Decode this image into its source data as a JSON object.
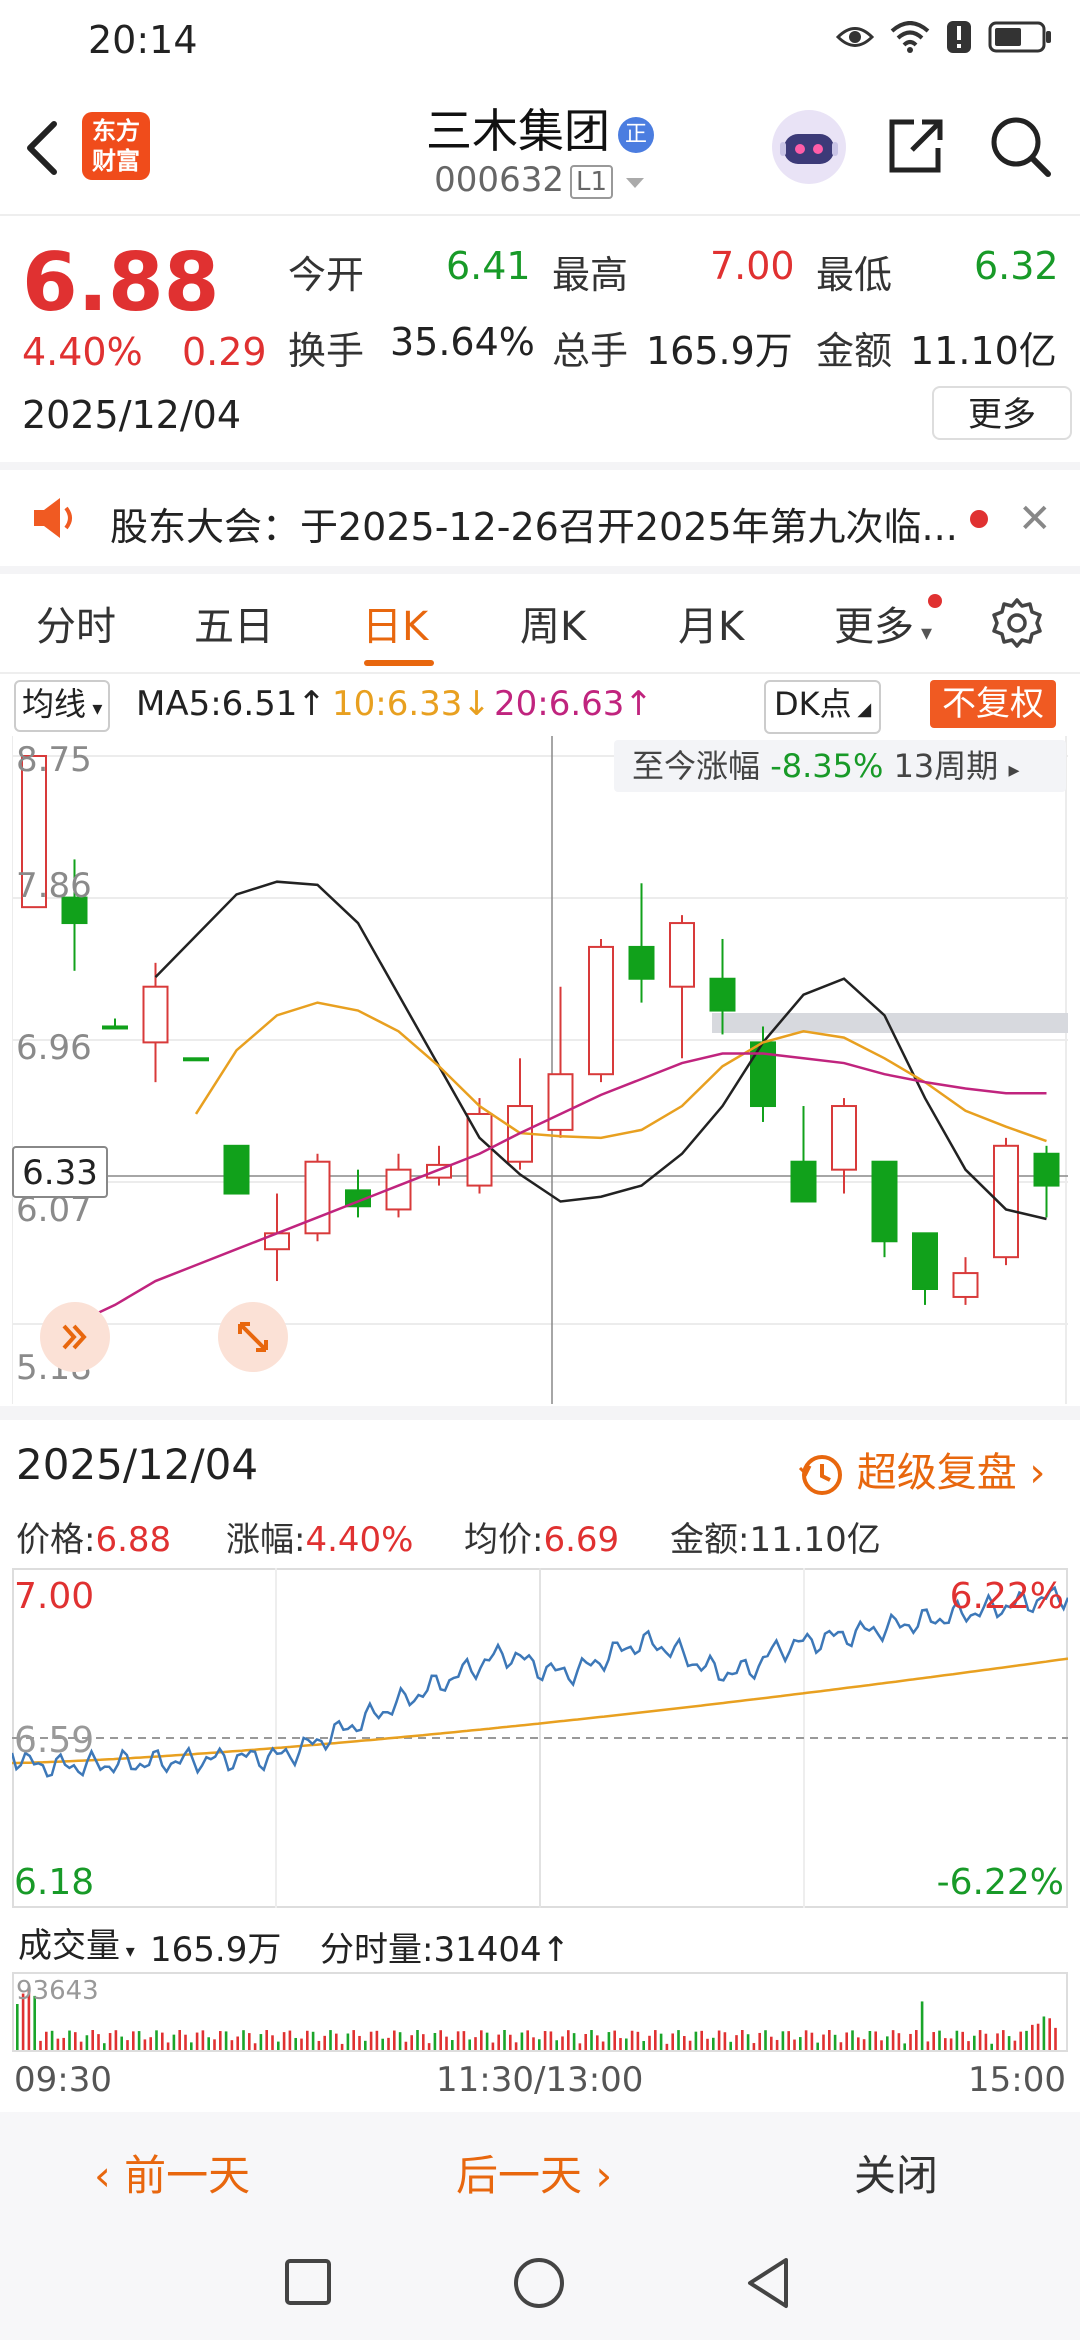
{
  "status": {
    "time": "20:14"
  },
  "header": {
    "logo_text": "东方财富",
    "stock_name": "三木集团",
    "stock_badge": "正",
    "stock_code": "000632",
    "level_badge": "L1"
  },
  "quote": {
    "price": "6.88",
    "change_pct": "4.40%",
    "change": "0.29",
    "date": "2025/12/04",
    "open_label": "今开",
    "open": "6.41",
    "high_label": "最高",
    "high": "7.00",
    "low_label": "最低",
    "low": "6.32",
    "turnover_label": "换手",
    "turnover": "35.64%",
    "volume_label": "总手",
    "volume": "165.9万",
    "amount_label": "金额",
    "amount": "11.10亿",
    "more_label": "更多"
  },
  "announcement": {
    "text": "股东大会：于2025-12-26召开2025年第九次临..."
  },
  "tabs": [
    "分时",
    "五日",
    "日K",
    "周K",
    "月K",
    "更多"
  ],
  "active_tab": "日K",
  "ma": {
    "selector": "均线",
    "ma5": "MA5:6.51↑",
    "ma10": "10:6.33↓",
    "ma20": "20:6.63↑",
    "dk": "DK点",
    "adjust": "不复权"
  },
  "kchart": {
    "y_labels": [
      "8.75",
      "7.86",
      "6.96",
      "6.07",
      "5.18"
    ],
    "crosshair_price": "6.33",
    "period_label": "至今涨幅",
    "period_change": "-8.35%",
    "period_count": "13周期",
    "colors": {
      "up": "#d83a3a",
      "down": "#11a11b",
      "ma5": "#222222",
      "ma10": "#e8a020",
      "ma20": "#c0247e"
    }
  },
  "chart_data": {
    "type": "candlestick",
    "y_range": [
      5.18,
      8.75
    ],
    "candles": [
      {
        "o": 7.8,
        "h": 8.75,
        "l": 7.8,
        "c": 8.75,
        "up": true
      },
      {
        "o": 7.86,
        "h": 8.1,
        "l": 7.4,
        "c": 7.7,
        "up": false
      },
      {
        "o": 7.05,
        "h": 7.1,
        "l": 7.05,
        "c": 7.05,
        "up": false
      },
      {
        "o": 6.95,
        "h": 7.45,
        "l": 6.7,
        "c": 7.3,
        "up": true
      },
      {
        "o": 6.85,
        "h": 6.85,
        "l": 6.85,
        "c": 6.85,
        "up": false
      },
      {
        "o": 6.3,
        "h": 6.3,
        "l": 6.0,
        "c": 6.0,
        "up": false
      },
      {
        "o": 5.65,
        "h": 6.0,
        "l": 5.45,
        "c": 5.75,
        "up": true
      },
      {
        "o": 5.75,
        "h": 6.25,
        "l": 5.7,
        "c": 6.2,
        "up": true
      },
      {
        "o": 6.02,
        "h": 6.15,
        "l": 5.85,
        "c": 5.92,
        "up": false
      },
      {
        "o": 5.9,
        "h": 6.25,
        "l": 5.85,
        "c": 6.15,
        "up": true
      },
      {
        "o": 6.1,
        "h": 6.3,
        "l": 6.05,
        "c": 6.18,
        "up": true
      },
      {
        "o": 6.05,
        "h": 6.6,
        "l": 6.0,
        "c": 6.5,
        "up": true
      },
      {
        "o": 6.2,
        "h": 6.85,
        "l": 6.15,
        "c": 6.55,
        "up": true
      },
      {
        "o": 6.4,
        "h": 7.3,
        "l": 6.35,
        "c": 6.75,
        "up": true
      },
      {
        "o": 6.75,
        "h": 7.6,
        "l": 6.7,
        "c": 7.55,
        "up": true
      },
      {
        "o": 7.55,
        "h": 7.95,
        "l": 7.2,
        "c": 7.35,
        "up": false
      },
      {
        "o": 7.3,
        "h": 7.75,
        "l": 6.85,
        "c": 7.7,
        "up": true
      },
      {
        "o": 7.35,
        "h": 7.6,
        "l": 7.0,
        "c": 7.15,
        "up": false
      },
      {
        "o": 6.95,
        "h": 7.05,
        "l": 6.45,
        "c": 6.55,
        "up": false
      },
      {
        "o": 6.2,
        "h": 6.55,
        "l": 5.95,
        "c": 5.95,
        "up": false
      },
      {
        "o": 6.15,
        "h": 6.6,
        "l": 6.0,
        "c": 6.55,
        "up": true
      },
      {
        "o": 6.2,
        "h": 6.2,
        "l": 5.6,
        "c": 5.7,
        "up": false
      },
      {
        "o": 5.75,
        "h": 5.75,
        "l": 5.3,
        "c": 5.4,
        "up": false
      },
      {
        "o": 5.35,
        "h": 5.6,
        "l": 5.3,
        "c": 5.5,
        "up": true
      },
      {
        "o": 5.6,
        "h": 6.35,
        "l": 5.55,
        "c": 6.3,
        "up": true
      },
      {
        "o": 6.25,
        "h": 6.3,
        "l": 5.85,
        "c": 6.05,
        "up": false
      }
    ],
    "ma5": [
      null,
      null,
      null,
      7.36,
      7.62,
      7.88,
      7.96,
      7.94,
      7.7,
      7.25,
      6.8,
      6.35,
      6.12,
      5.95,
      5.98,
      6.05,
      6.25,
      6.55,
      6.95,
      7.25,
      7.35,
      7.12,
      6.6,
      6.15,
      5.9,
      5.84
    ],
    "ma10": [
      null,
      null,
      null,
      null,
      6.5,
      6.9,
      7.12,
      7.2,
      7.15,
      7.02,
      6.8,
      6.55,
      6.38,
      6.36,
      6.35,
      6.4,
      6.55,
      6.8,
      6.95,
      7.02,
      6.98,
      6.85,
      6.7,
      6.52,
      6.42,
      6.33
    ],
    "ma20": [
      null,
      5.18,
      5.3,
      5.45,
      5.55,
      5.65,
      5.75,
      5.85,
      5.95,
      6.05,
      6.15,
      6.25,
      6.38,
      6.5,
      6.62,
      6.72,
      6.82,
      6.88,
      6.88,
      6.85,
      6.82,
      6.75,
      6.7,
      6.66,
      6.63,
      6.63
    ]
  },
  "intraday": {
    "date": "2025/12/04",
    "replay_label": "超级复盘",
    "price_label": "价格:",
    "price": "6.88",
    "change_label": "涨幅:",
    "change_pct": "4.40%",
    "avg_label": "均价:",
    "avg": "6.69",
    "amount_label": "金额:",
    "amount": "11.10亿",
    "y_top": "7.00",
    "y_mid": "6.59",
    "y_bot": "6.18",
    "pct_top": "6.22%",
    "pct_bot": "-6.22%",
    "vol_selector": "成交量",
    "vol_total": "165.9万",
    "tick_vol_label": "分时量:",
    "tick_vol": "31404↑",
    "vol_max": "93643",
    "times": [
      "09:30",
      "11:30/13:00",
      "15:00"
    ]
  },
  "bottom": {
    "prev": "前一天",
    "next": "后一天",
    "close": "关闭"
  }
}
